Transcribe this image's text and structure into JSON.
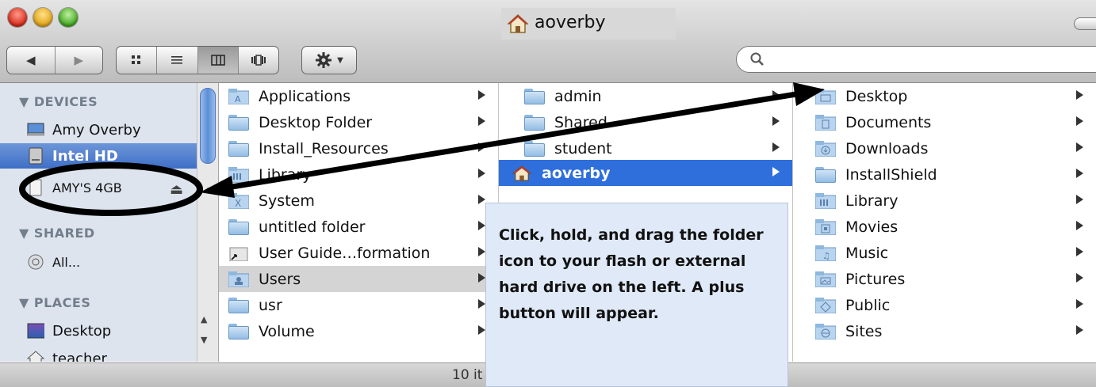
{
  "window": {
    "title": "aoverby",
    "title_icon": "home-icon"
  },
  "toolbar": {
    "back_icon": "back-arrow-icon",
    "forward_icon": "forward-arrow-icon",
    "view_modes": [
      "icon-view",
      "list-view",
      "column-view",
      "cover-flow-view"
    ],
    "active_view": "column-view",
    "action_icon": "gear-icon",
    "search": {
      "value": "",
      "placeholder": ""
    }
  },
  "sidebar": {
    "devices_header": "▼ DEVICES",
    "shared_header": "▼ SHARED",
    "places_header": "▼ PLACES",
    "devices": [
      {
        "label": "Amy Overby",
        "icon": "computer-icon"
      },
      {
        "label": "Intel HD",
        "icon": "hard-drive-icon",
        "selected": true
      },
      {
        "label": "AMY'S 4GB",
        "icon": "usb-drive-icon",
        "eject": "⏏"
      }
    ],
    "shared": [
      {
        "label": "All...",
        "icon": "network-icon"
      }
    ],
    "places": [
      {
        "label": "Desktop",
        "icon": "desktop-icon"
      },
      {
        "label": "teacher",
        "icon": "home-icon"
      }
    ]
  },
  "columns": {
    "col1": [
      {
        "label": "Applications",
        "arrow": true,
        "icon": "applications-folder-icon"
      },
      {
        "label": "Desktop Folder",
        "arrow": true
      },
      {
        "label": "Install_Resources",
        "arrow": true
      },
      {
        "label": "Library",
        "arrow": true,
        "icon": "library-folder-icon"
      },
      {
        "label": "System",
        "arrow": true,
        "icon": "system-folder-icon"
      },
      {
        "label": "untitled folder",
        "arrow": true
      },
      {
        "label": "User Guide…formation",
        "arrow": true,
        "icon": "alias-icon"
      },
      {
        "label": "Users",
        "arrow": true,
        "state": "highlighted",
        "icon": "users-folder-icon"
      },
      {
        "label": "usr",
        "arrow": true
      },
      {
        "label": "Volume",
        "arrow": true
      }
    ],
    "col2": [
      {
        "label": "admin",
        "arrow": true
      },
      {
        "label": "Shared",
        "arrow": true
      },
      {
        "label": "student",
        "arrow": true
      },
      {
        "label": "aoverby",
        "arrow": true,
        "state": "selected",
        "icon": "home-icon"
      }
    ],
    "col3": [
      {
        "label": "Desktop",
        "arrow": true
      },
      {
        "label": "Documents",
        "arrow": true
      },
      {
        "label": "Downloads",
        "arrow": true
      },
      {
        "label": "InstallShield",
        "arrow": true
      },
      {
        "label": "Library",
        "arrow": true
      },
      {
        "label": "Movies",
        "arrow": true
      },
      {
        "label": "Music",
        "arrow": true
      },
      {
        "label": "Pictures",
        "arrow": true
      },
      {
        "label": "Public",
        "arrow": true
      },
      {
        "label": "Sites",
        "arrow": true
      }
    ]
  },
  "statusbar": {
    "text": "10 it"
  },
  "annotation": {
    "callout": "Click, hold, and drag the folder icon to your flash or external hard drive on the left. A plus button will appear.",
    "color": "#000000"
  },
  "colors": {
    "selection": "#2f6fdc",
    "sidebar_bg": "#dde4ee",
    "callout_bg": "#dfe9f7"
  }
}
